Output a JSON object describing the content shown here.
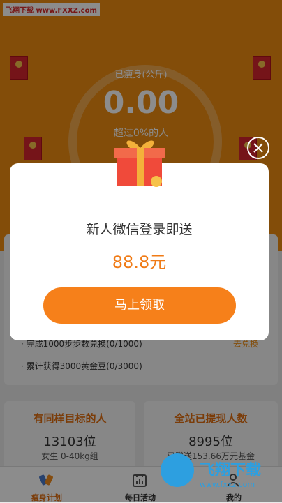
{
  "watermark": "飞翔下载 www.FXXZ.com",
  "hero": {
    "label": "已瘦身(公斤)",
    "value": "0.00",
    "subtitle": "超过0%的人"
  },
  "tasks": [
    {
      "text": "· 完成1000步步数兑换(0/1000)",
      "action": "去兑换"
    },
    {
      "text": "· 累计获得3000黄金豆(0/3000)",
      "action": ""
    }
  ],
  "stats": [
    {
      "title": "有同样目标的人",
      "value": "13103位",
      "sub": "女生 0-40kg组"
    },
    {
      "title": "全站已提现人数",
      "value": "8995位",
      "sub": "已赠送153.66万元基金"
    }
  ],
  "tabs": [
    {
      "label": "瘦身计划",
      "icon": "plan-icon"
    },
    {
      "label": "每日活动",
      "icon": "calendar-icon"
    },
    {
      "label": "我的",
      "icon": "user-icon"
    }
  ],
  "brand": {
    "name": "飞翔下载",
    "url": "www.fxxz.com"
  },
  "modal": {
    "title": "新人微信登录即送",
    "amount": "88.8元",
    "button": "马上领取"
  },
  "colors": {
    "accent": "#ef8c12",
    "button": "#f6801a",
    "amount": "#f07b16"
  }
}
